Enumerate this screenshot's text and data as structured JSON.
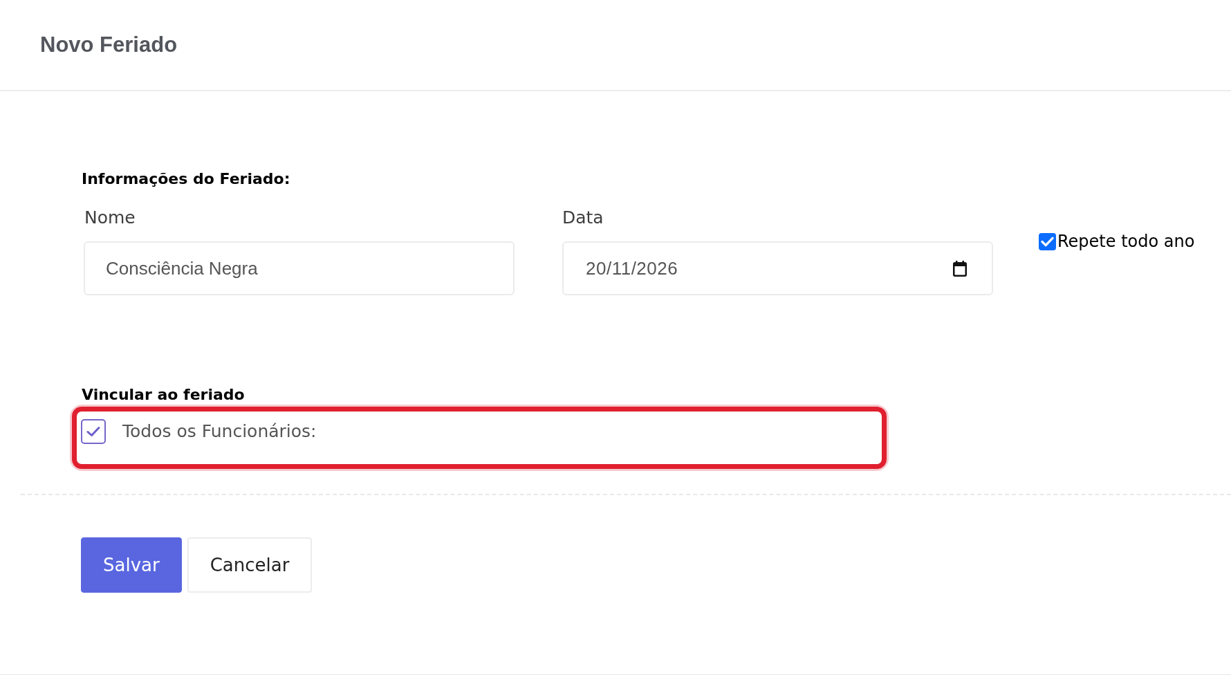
{
  "header": {
    "title": "Novo Feriado"
  },
  "holiday_info": {
    "heading": "Informações do Feriado:",
    "name_field": {
      "label": "Nome",
      "value": "Consciência Negra"
    },
    "date_field": {
      "label": "Data",
      "value": "20/11/2026"
    },
    "repeat_yearly": {
      "label": "Repete todo ano",
      "checked": true
    }
  },
  "link_section": {
    "heading": "Vincular ao feriado",
    "options": [
      {
        "label": "Todos os Funcionários:",
        "checked": true,
        "highlighted": true
      }
    ]
  },
  "buttons": [
    {
      "label": "Salvar",
      "kind": "primary"
    },
    {
      "label": "Cancelar",
      "kind": "secondary"
    }
  ]
}
